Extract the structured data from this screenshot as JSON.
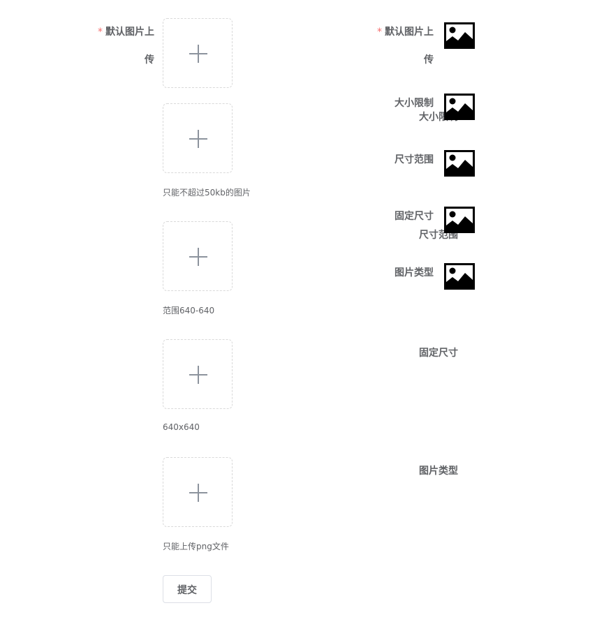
{
  "form": {
    "fields": [
      {
        "label": "默认图片上传",
        "required": true,
        "tip": ""
      },
      {
        "label": "大小限制",
        "required": false,
        "tip": "只能不超过50kb的图片"
      },
      {
        "label": "尺寸范围",
        "required": false,
        "tip": "范围640-640"
      },
      {
        "label": "固定尺寸",
        "required": false,
        "tip": "640x640"
      },
      {
        "label": "图片类型",
        "required": false,
        "tip": "只能上传png文件"
      }
    ],
    "required_mark": "*",
    "submit_label": "提交"
  },
  "preview": {
    "fields": [
      {
        "label": "默认图片上传",
        "required": true,
        "icon": "image-placeholder-icon"
      },
      {
        "label": "大小限制",
        "required": false,
        "icon": "image-placeholder-icon"
      },
      {
        "label": "尺寸范围",
        "required": false,
        "icon": "image-placeholder-icon"
      },
      {
        "label": "固定尺寸",
        "required": false,
        "icon": "image-placeholder-icon"
      },
      {
        "label": "图片类型",
        "required": false,
        "icon": "image-placeholder-icon"
      }
    ]
  },
  "colors": {
    "required": "#f56c6c",
    "text": "#606266",
    "border": "#d9d9d9",
    "plus": "#8c939d"
  }
}
